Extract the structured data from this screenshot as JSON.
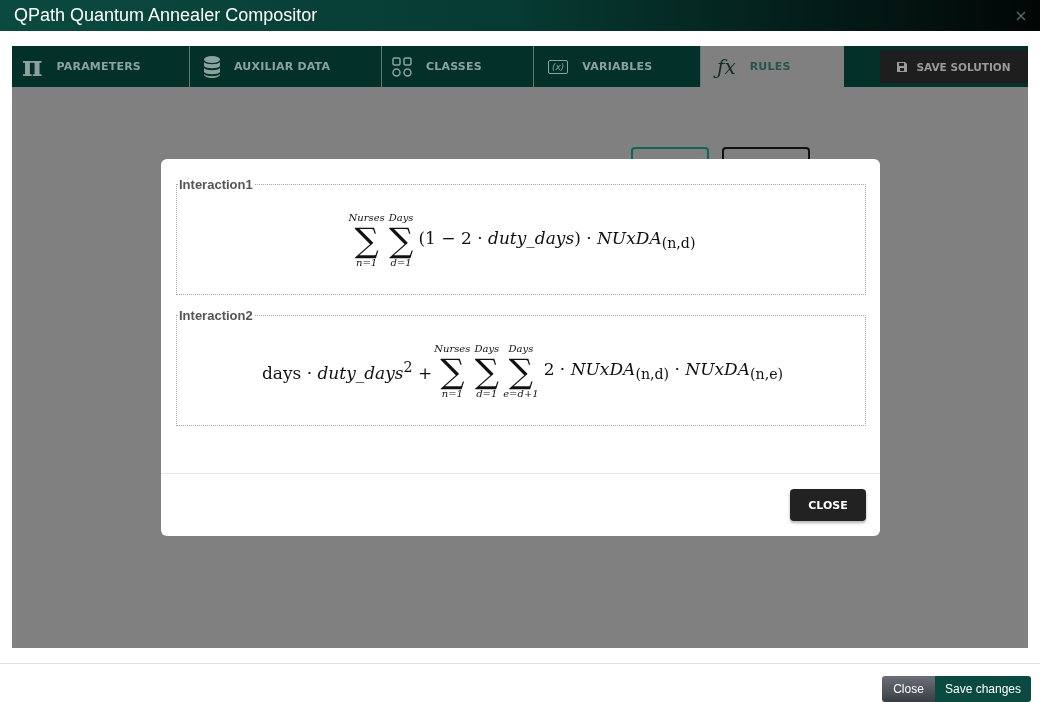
{
  "window": {
    "title": "QPath Quantum Annealer Compositor"
  },
  "tabs": [
    {
      "label": "PARAMETERS",
      "selected": false,
      "icon": {
        "kind": "glyph",
        "glyph": "π"
      }
    },
    {
      "label": "AUXILIAR DATA",
      "selected": false,
      "icon": {
        "kind": "database"
      }
    },
    {
      "label": "CLASSES",
      "selected": false,
      "icon": {
        "kind": "grid"
      }
    },
    {
      "label": "VARIABLES",
      "selected": false,
      "icon": {
        "kind": "boxed",
        "glyph": "(x)"
      }
    },
    {
      "label": "RULES",
      "selected": true,
      "icon": {
        "kind": "glyph",
        "glyph": "ƒx"
      }
    }
  ],
  "save_solution_button": "SAVE SOLUTION",
  "dialog": {
    "sections": [
      {
        "legend": "Interaction1",
        "formula": [
          {
            "kind": "sum",
            "symbol": "∑",
            "upper": "Nurses",
            "lower": "n=1"
          },
          {
            "kind": "sum",
            "symbol": "∑",
            "upper": "Days",
            "lower": "d=1"
          },
          {
            "kind": "term",
            "text": "(1 − 2 · *duty_days*) · *NUxDA*$_{(n,d)}$"
          }
        ]
      },
      {
        "legend": "Interaction2",
        "formula": [
          {
            "kind": "term",
            "text": "days · *duty_days*$^{2}$ +"
          },
          {
            "kind": "sum",
            "symbol": "∑",
            "upper": "Nurses",
            "lower": "n=1"
          },
          {
            "kind": "sum",
            "symbol": "∑",
            "upper": "Days",
            "lower": "d=1"
          },
          {
            "kind": "sum",
            "symbol": "∑",
            "upper": "Days",
            "lower": "e=d+1"
          },
          {
            "kind": "term",
            "text": "2 · *NUxDA*$_{(n,d)}$ · *NUxDA*$_{(n,e)}$"
          }
        ]
      }
    ],
    "close_button": "CLOSE"
  },
  "footer_buttons": [
    {
      "label": "Close",
      "kind": "secondary"
    },
    {
      "label": "Save changes",
      "kind": "primary"
    }
  ]
}
